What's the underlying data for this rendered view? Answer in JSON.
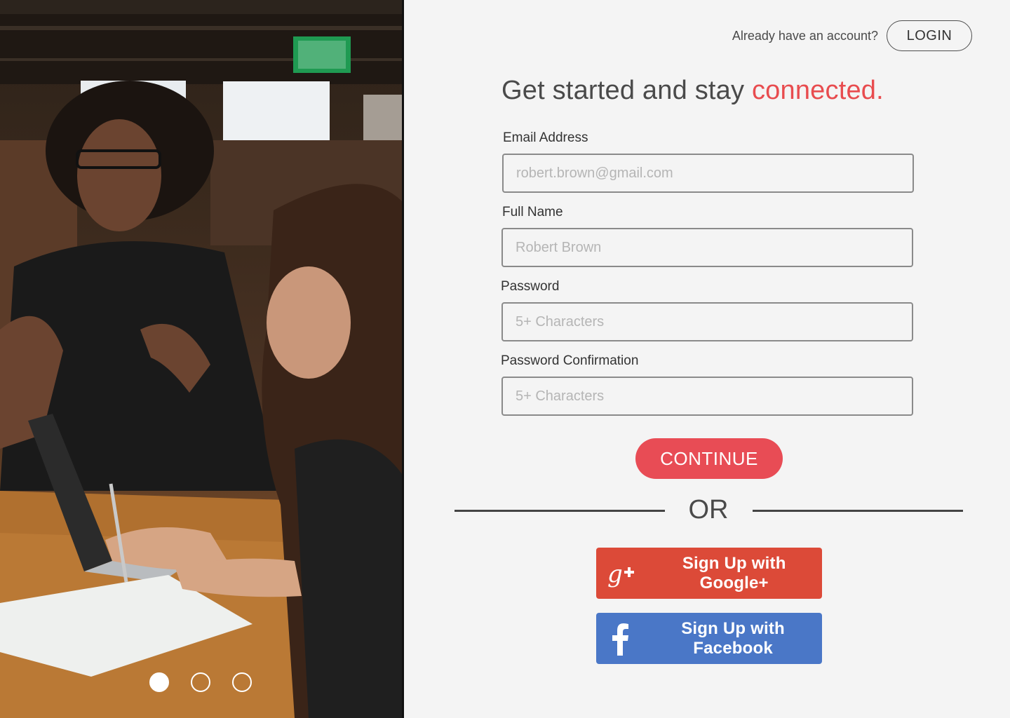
{
  "header": {
    "prompt": "Already have an account?",
    "login_label": "LOGIN"
  },
  "headline": {
    "main": "Get started and stay ",
    "accent": "connected."
  },
  "form": {
    "email": {
      "label": "Email Address",
      "placeholder": "robert.brown@gmail.com"
    },
    "full_name": {
      "label": "Full Name",
      "placeholder": "Robert Brown"
    },
    "password": {
      "label": "Password",
      "placeholder": "5+ Characters"
    },
    "password_confirmation": {
      "label": "Password Confirmation",
      "placeholder": "5+ Characters"
    },
    "continue_label": "CONTINUE"
  },
  "divider": {
    "text": "OR"
  },
  "social": {
    "google": {
      "label": "Sign Up with Google+",
      "icon": "google-plus-icon",
      "color": "#dc4a38"
    },
    "facebook": {
      "label": "Sign Up with Facebook",
      "icon": "facebook-icon",
      "color": "#4a77c7"
    }
  },
  "carousel": {
    "slides": 3,
    "active_slide": 1
  },
  "colors": {
    "accent": "#e84c4f",
    "background": "#f4f4f4"
  }
}
